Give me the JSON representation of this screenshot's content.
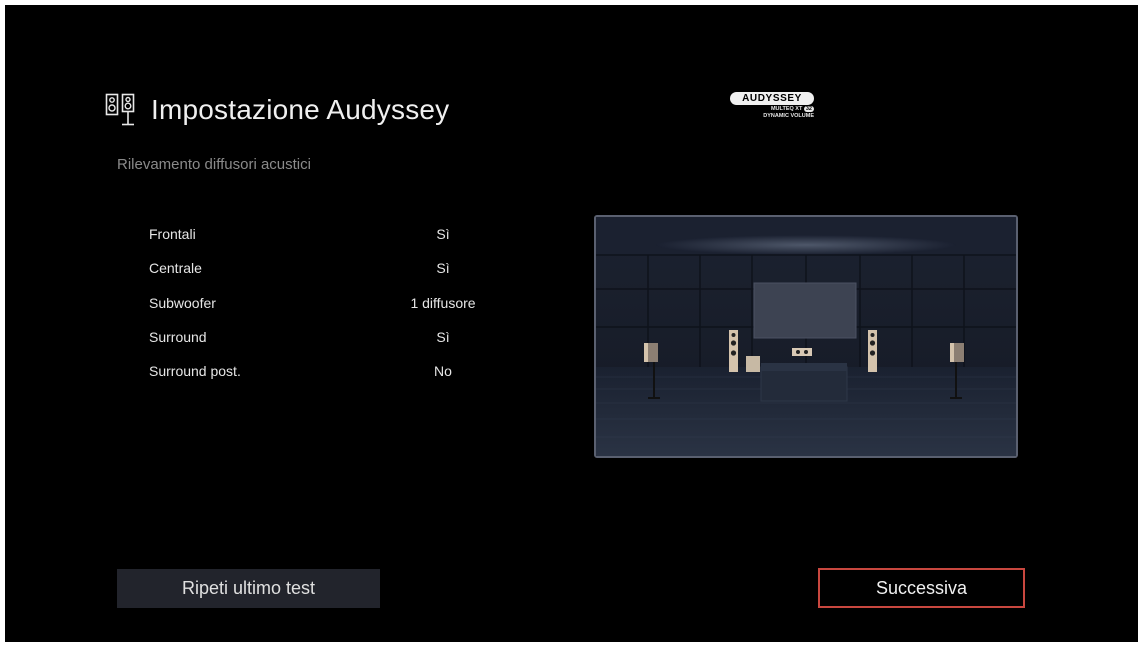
{
  "header": {
    "title": "Impostazione Audyssey",
    "icon": "speakers-icon",
    "subtitle": "Rilevamento diffusori acustici"
  },
  "logo": {
    "brand": "AUDYSSEY",
    "line1": "MULTEQ XT",
    "badge": "32",
    "line2": "DYNAMIC VOLUME"
  },
  "speakers": [
    {
      "label": "Frontali",
      "value": "Sì"
    },
    {
      "label": "Centrale",
      "value": "Sì"
    },
    {
      "label": "Subwoofer",
      "value": "1 diffusore"
    },
    {
      "label": "Surround",
      "value": "Sì"
    },
    {
      "label": "Surround post.",
      "value": "No"
    }
  ],
  "buttons": {
    "repeat": "Ripeti ultimo test",
    "next": "Successiva"
  },
  "colors": {
    "background": "#000000",
    "focus_border": "#c9473f",
    "button_bg": "#22242c"
  }
}
